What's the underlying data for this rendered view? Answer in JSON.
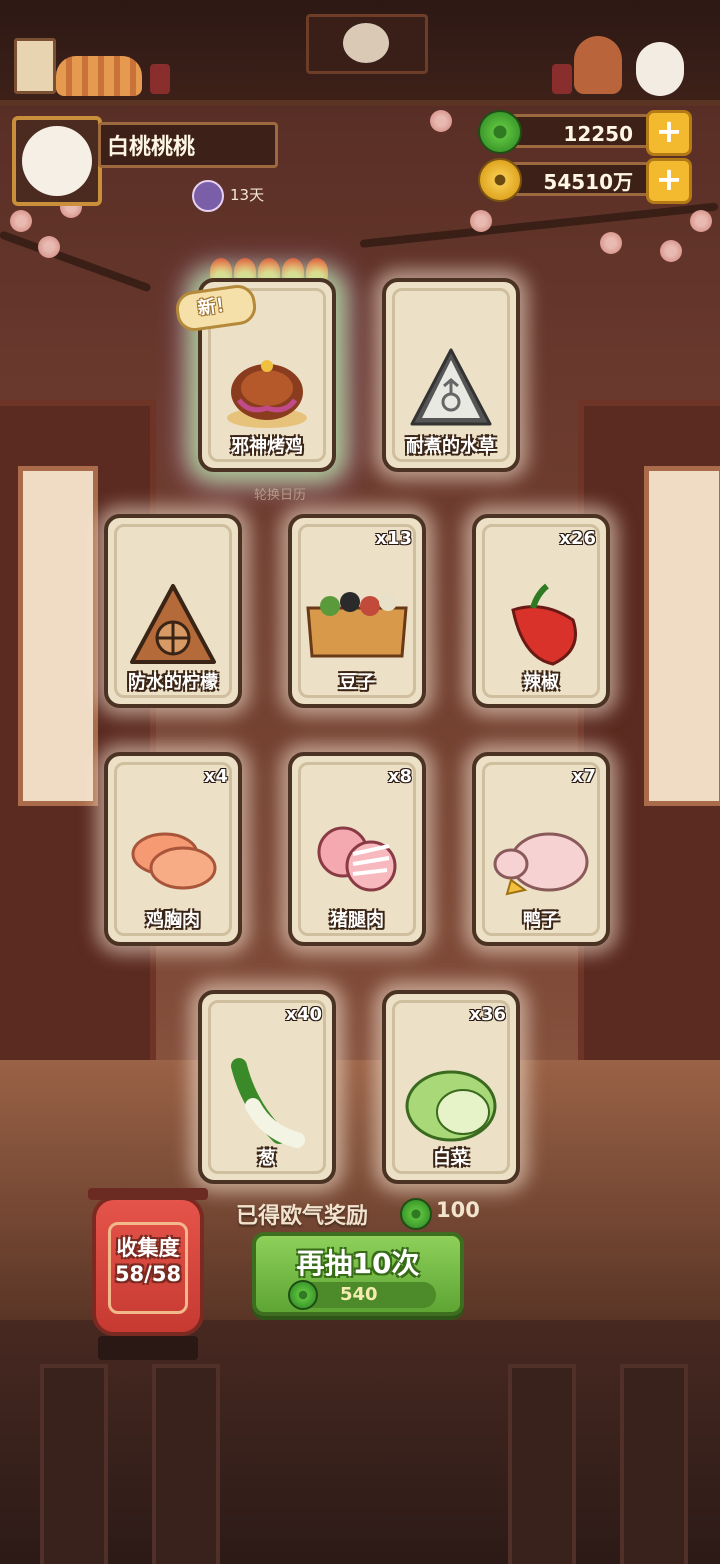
{
  "player": {
    "name": "白桃桃桃",
    "days": "13天"
  },
  "currency": {
    "jade": "12250",
    "coins": "54510万"
  },
  "new_badge": "新！",
  "rotate_label": "轮换日历",
  "cards": [
    {
      "name": "邪神烤鸡",
      "qty": "",
      "icon": "roast-chicken-icon",
      "is_new": true
    },
    {
      "name": "耐煮的水草",
      "qty": "",
      "icon": "waterweed-icon",
      "is_new": false
    },
    {
      "name": "防水的柠檬",
      "qty": "",
      "icon": "lemon-icon",
      "is_new": false
    },
    {
      "name": "豆子",
      "qty": "x13",
      "icon": "beans-icon",
      "is_new": false
    },
    {
      "name": "辣椒",
      "qty": "x26",
      "icon": "chili-icon",
      "is_new": false
    },
    {
      "name": "鸡胸肉",
      "qty": "x4",
      "icon": "chicken-breast-icon",
      "is_new": false
    },
    {
      "name": "猪腿肉",
      "qty": "x8",
      "icon": "pork-leg-icon",
      "is_new": false
    },
    {
      "name": "鸭子",
      "qty": "x7",
      "icon": "duck-icon",
      "is_new": false
    },
    {
      "name": "葱",
      "qty": "x40",
      "icon": "scallion-icon",
      "is_new": false
    },
    {
      "name": "白菜",
      "qty": "x36",
      "icon": "cabbage-icon",
      "is_new": false
    }
  ],
  "reward": {
    "label": "已得欧气奖励",
    "value": "100"
  },
  "draw": {
    "label": "再抽10次",
    "cost": "540"
  },
  "collection": {
    "label": "收集度",
    "value": "58/58"
  },
  "colors": {
    "accent_green": "#5ea534",
    "gold": "#f3b92f",
    "card_bg": "#ece0c6",
    "lantern_red": "#d8463e"
  }
}
